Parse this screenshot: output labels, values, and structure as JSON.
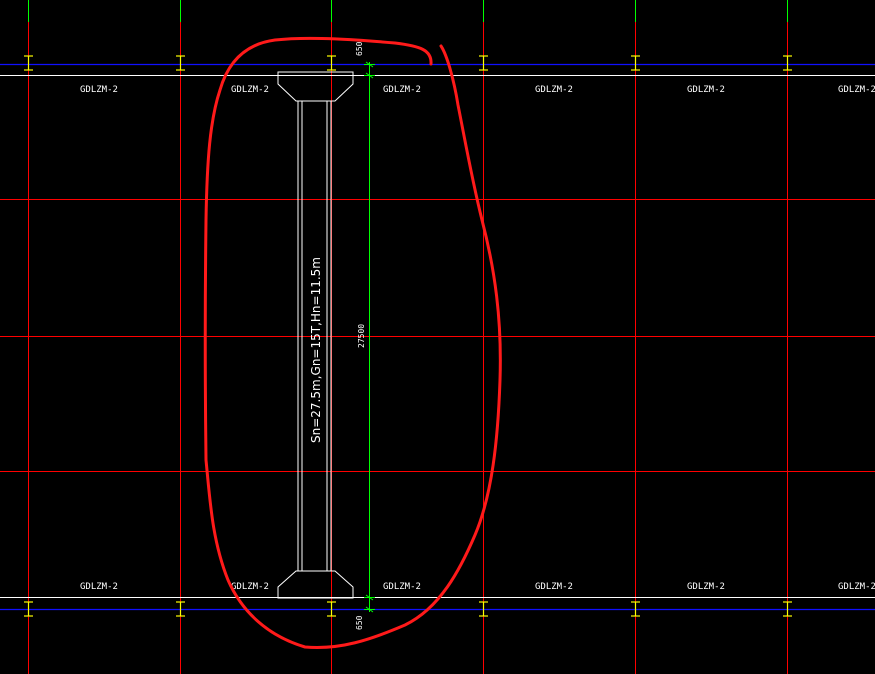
{
  "drawing": {
    "column_labels": {
      "top": [
        "GDLZM-2",
        "GDLZM-2",
        "GDLZM-2",
        "GDLZM-2",
        "GDLZM-2",
        "GDLZM-2"
      ],
      "bottom": [
        "GDLZM-2",
        "GDLZM-2",
        "GDLZM-2",
        "GDLZM-2",
        "GDLZM-2",
        "GDLZM-2"
      ]
    },
    "dimensions": {
      "top_offset": "650",
      "span": "27500",
      "bottom_offset": "650"
    },
    "crane": {
      "label": "Sn=27.5m,Gn=15T,Hn=11.5m"
    },
    "colors": {
      "background": "#000000",
      "grid_red": "#ff0000",
      "axis_blue": "#0000ff",
      "beam_white": "#ffffff",
      "dimension_green": "#00ff00",
      "markup_red": "#ff1a1a",
      "column_yellow": "#ffff00"
    }
  }
}
